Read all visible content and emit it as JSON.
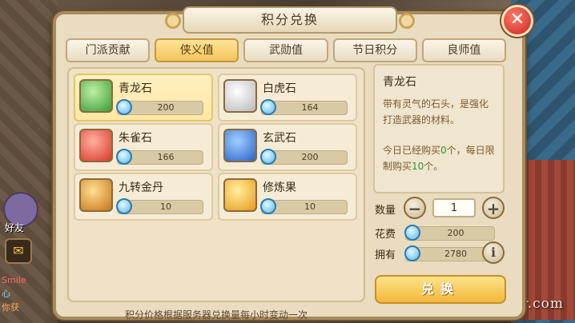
{
  "dialog": {
    "title": "积分兑换",
    "close_label": "✕"
  },
  "tabs": [
    {
      "label": "门派贡献",
      "active": false
    },
    {
      "label": "侠义值",
      "active": true
    },
    {
      "label": "武勋值",
      "active": false
    },
    {
      "label": "节日积分",
      "active": false
    },
    {
      "label": "良师值",
      "active": false
    }
  ],
  "items": [
    {
      "name": "青龙石",
      "price": "200",
      "icon": "qinglong-stone-icon",
      "color": "#4caa4c",
      "selected": true
    },
    {
      "name": "白虎石",
      "price": "164",
      "icon": "baihu-stone-icon",
      "color": "#e8e8e8",
      "selected": false
    },
    {
      "name": "朱雀石",
      "price": "166",
      "icon": "zhuque-stone-icon",
      "color": "#e85a4a",
      "selected": false
    },
    {
      "name": "玄武石",
      "price": "200",
      "icon": "xuanwu-stone-icon",
      "color": "#3a7ad8",
      "selected": false
    },
    {
      "name": "九转金丹",
      "price": "10",
      "icon": "golden-pill-icon",
      "color": "#e8a42a",
      "selected": false
    },
    {
      "name": "修炼果",
      "price": "10",
      "icon": "training-fruit-icon",
      "color": "#f2b82a",
      "selected": false
    }
  ],
  "note": "积分价格根据服务器兑换量每小时变动一次",
  "detail": {
    "name": "青龙石",
    "desc": "带有灵气的石头，是强化打造武器的材料。",
    "limit_prefix": "今日已经购买",
    "bought": "0",
    "limit_mid": "个，每日限制购买",
    "limit": "10",
    "limit_suffix": "个。"
  },
  "purchase": {
    "qty_label": "数量",
    "qty_value": "1",
    "cost_label": "花费",
    "cost_value": "200",
    "own_label": "拥有",
    "own_value": "2780",
    "minus": "−",
    "plus": "+",
    "info": "i",
    "exchange_label": "兑换"
  },
  "background": {
    "friend_label": "好友",
    "chat": [
      "Smile",
      "心",
      "你获"
    ],
    "watermark": "Ygamer.com"
  }
}
